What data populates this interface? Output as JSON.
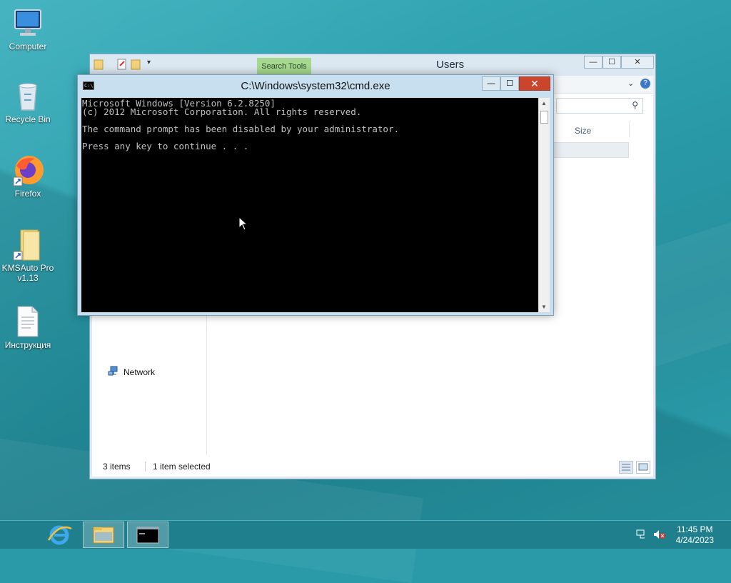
{
  "desktop": {
    "icons": [
      {
        "label": "Computer",
        "icon": "computer-icon"
      },
      {
        "label": "Recycle Bin",
        "icon": "recycle-bin-icon"
      },
      {
        "label": "Firefox",
        "icon": "firefox-icon"
      },
      {
        "label": "KMSAuto Pro v1.13",
        "icon": "folder-shortcut-icon"
      },
      {
        "label": "Инструкция",
        "icon": "text-document-icon"
      }
    ]
  },
  "explorer": {
    "title": "Users",
    "search_tools_tab": "Search Tools",
    "column_size": "Size",
    "nav_network": "Network",
    "status_items": "3 items",
    "status_selected": "1 item selected"
  },
  "cmd": {
    "title": "C:\\Windows\\system32\\cmd.exe",
    "lines": [
      "Microsoft Windows [Version 6.2.8250]",
      "(c) 2012 Microsoft Corporation. All rights reserved.",
      "",
      "The command prompt has been disabled by your administrator.",
      "",
      "Press any key to continue . . ."
    ]
  },
  "taskbar": {
    "time": "11:45 PM",
    "date": "4/24/2023"
  },
  "colors": {
    "desktop_bg": "#2a9aa8",
    "taskbar_bg": "#1f7f8d",
    "cmd_close": "#c9462c",
    "search_tools": "#a6d88f"
  }
}
